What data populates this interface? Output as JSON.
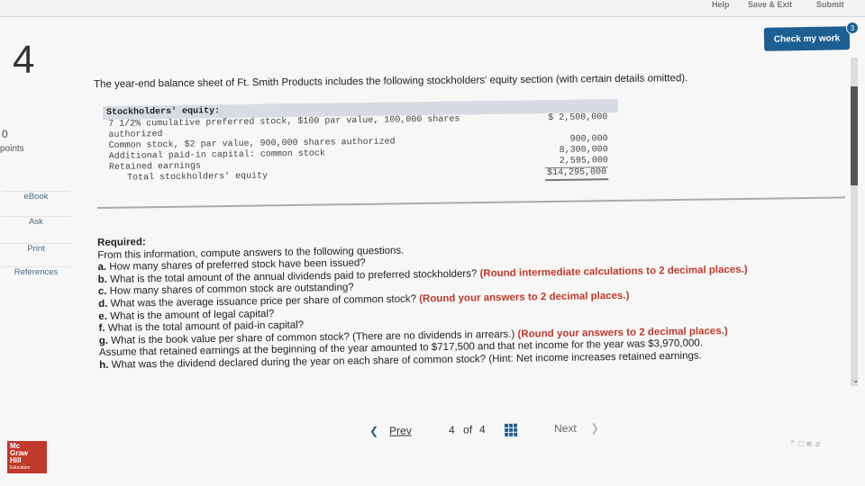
{
  "topbar": {
    "help": "Help",
    "save_exit": "Save & Exit",
    "submit": "Submit"
  },
  "question": {
    "number": "4"
  },
  "sidebar": {
    "points_value": "0",
    "points_label": "points",
    "links": [
      "eBook",
      "Ask",
      "Print",
      "References"
    ]
  },
  "check_button": {
    "label": "Check my work",
    "badge": "3"
  },
  "intro": "The year-end balance sheet of Ft. Smith Products includes the following stockholders' equity section (with certain details omitted).",
  "balance_sheet": {
    "header": "Stockholders' equity:",
    "rows": [
      {
        "label": "7 1/2% cumulative preferred stock, $100 par value, 100,000 shares",
        "amount": "$ 2,500,000"
      },
      {
        "label": "authorized",
        "amount": ""
      },
      {
        "label": "Common stock, $2 par value, 900,000 shares authorized",
        "amount": "900,000"
      },
      {
        "label": "Additional paid-in capital: common stock",
        "amount": "8,300,000"
      },
      {
        "label": "Retained earnings",
        "amount": "2,595,000"
      },
      {
        "label": "Total stockholders' equity",
        "amount": "$14,295,000"
      }
    ]
  },
  "required": {
    "heading": "Required:",
    "lead": "From this information, compute answers to the following questions.",
    "a": {
      "letter": "a.",
      "text": "How many shares of preferred stock have been issued?",
      "note": ""
    },
    "b": {
      "letter": "b.",
      "text": "What is the total amount of the annual dividends paid to preferred stockholders?",
      "note": "(Round intermediate calculations to 2 decimal places.)"
    },
    "c": {
      "letter": "c.",
      "text": "How many shares of common stock are outstanding?",
      "note": ""
    },
    "d": {
      "letter": "d.",
      "text": "What was the average issuance price per share of common stock?",
      "note": "(Round your answers to 2 decimal places.)"
    },
    "e": {
      "letter": "e.",
      "text": "What is the amount of legal capital?",
      "note": ""
    },
    "f": {
      "letter": "f.",
      "text": "What is the total amount of paid-in capital?",
      "note": ""
    },
    "g": {
      "letter": "g.",
      "text": "What is the book value per share of common stock? (There are no dividends in arrears.)",
      "note": "(Round your answers to 2 decimal places.)",
      "tail": "Assume that retained earnings at the beginning of the year amounted to $717,500 and that net income for the year was $3,970,000."
    },
    "h": {
      "letter": "h.",
      "text": "What was the dividend declared during the year on each share of common stock? (Hint: Net income increases retained earnings.",
      "note": ""
    }
  },
  "pager": {
    "prev": "Prev",
    "current": "4",
    "of": "of",
    "total": "4",
    "next": "Next"
  },
  "logo": {
    "line1": "Mc",
    "line2": "Graw",
    "line3": "Hill",
    "line4": "Education"
  }
}
